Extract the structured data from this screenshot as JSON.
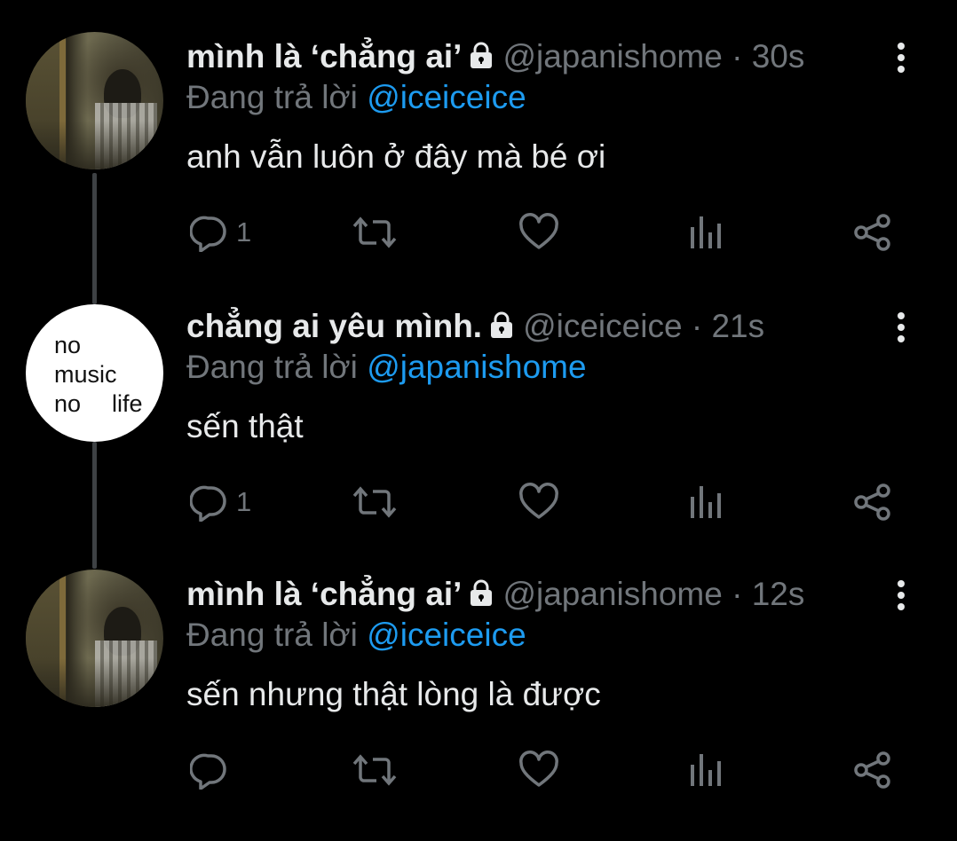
{
  "tweets": [
    {
      "name": "mình là ‘chẳng ai’",
      "handle": "@japanishome",
      "dot": "·",
      "time": "30s",
      "replying_label": "Đang trả lời",
      "replying_to": "@iceiceice",
      "text": "anh vẫn luôn ở đây mà bé ơi",
      "reply_count": "1",
      "avatar": "photo"
    },
    {
      "name": "chẳng ai yêu mình.",
      "handle": "@iceiceice",
      "dot": "·",
      "time": "21s",
      "replying_label": "Đang trả lời",
      "replying_to": "@japanishome",
      "text": "sến thật",
      "reply_count": "1",
      "avatar_text": [
        "no",
        "music",
        "no",
        "life"
      ]
    },
    {
      "name": "mình là ‘chẳng ai’",
      "handle": "@japanishome",
      "dot": "·",
      "time": "12s",
      "replying_label": "Đang trả lời",
      "replying_to": "@iceiceice",
      "text": "sến nhưng thật lòng là được",
      "reply_count": "",
      "avatar": "photo"
    }
  ],
  "icons": {
    "lock": "lock-icon",
    "more": "more-vertical-icon",
    "reply": "reply-bubble-icon",
    "retweet": "retweet-icon",
    "like": "heart-icon",
    "views": "views-chart-icon",
    "share": "share-icon"
  },
  "colors": {
    "background": "#000000",
    "text": "#e7e9ea",
    "muted": "#71767b",
    "link": "#1d9bf0",
    "thread_line": "#3e4144"
  }
}
